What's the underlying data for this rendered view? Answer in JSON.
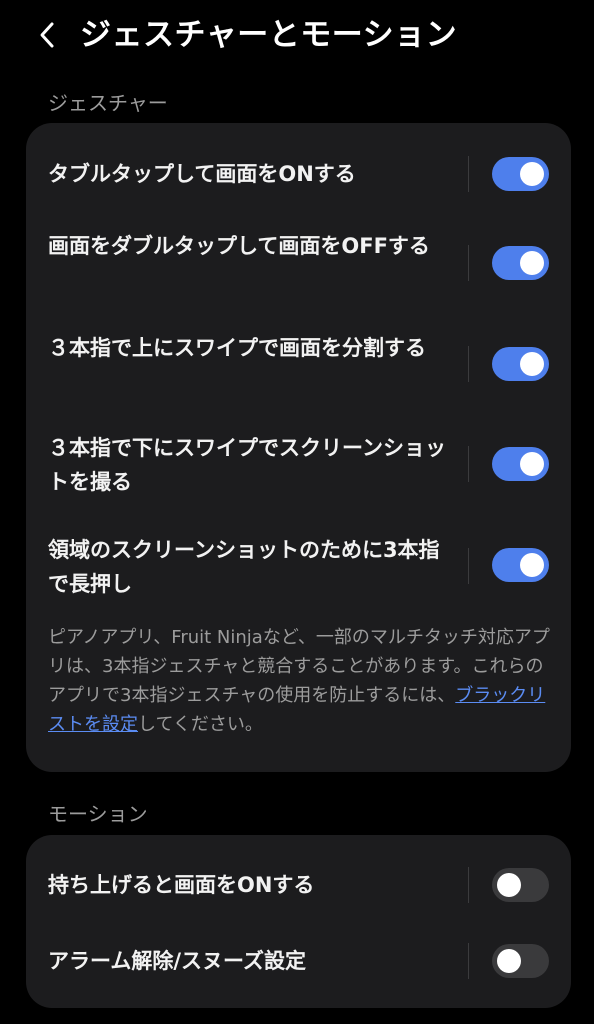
{
  "header": {
    "back_icon": "chevron-left-icon",
    "title": "ジェスチャーとモーション"
  },
  "colors": {
    "background": "#000000",
    "card": "#1c1c1e",
    "toggle_on": "#4e7fec",
    "toggle_off": "#3a3a3c",
    "link": "#5b8cf3",
    "secondary_text": "#9c9c9c"
  },
  "gestures": {
    "section_label": "ジェスチャー",
    "items": [
      {
        "label": "タブルタップして画面をONする",
        "enabled": true
      },
      {
        "label": "画面をダブルタップして画面をOFFする",
        "enabled": true
      },
      {
        "label": "３本指で上にスワイプで画面を分割する",
        "enabled": true
      },
      {
        "label": "３本指で下にスワイプでスクリーンショットを撮る",
        "enabled": true
      },
      {
        "label": "領域のスクリーンショットのために3本指で長押し",
        "enabled": true
      }
    ],
    "note": {
      "text_before": "ピアノアプリ、Fruit Ninjaなど、一部のマルチタッチ対応アプリは、3本指ジェスチャと競合することがあります。これらのアプリで3本指ジェスチャの使用を防止するには、",
      "link": "ブラックリストを設定",
      "text_after": "してください。"
    }
  },
  "motion": {
    "section_label": "モーション",
    "items": [
      {
        "label": "持ち上げると画面をONする",
        "enabled": false
      },
      {
        "label": "アラーム解除/スヌーズ設定",
        "enabled": false
      }
    ]
  }
}
